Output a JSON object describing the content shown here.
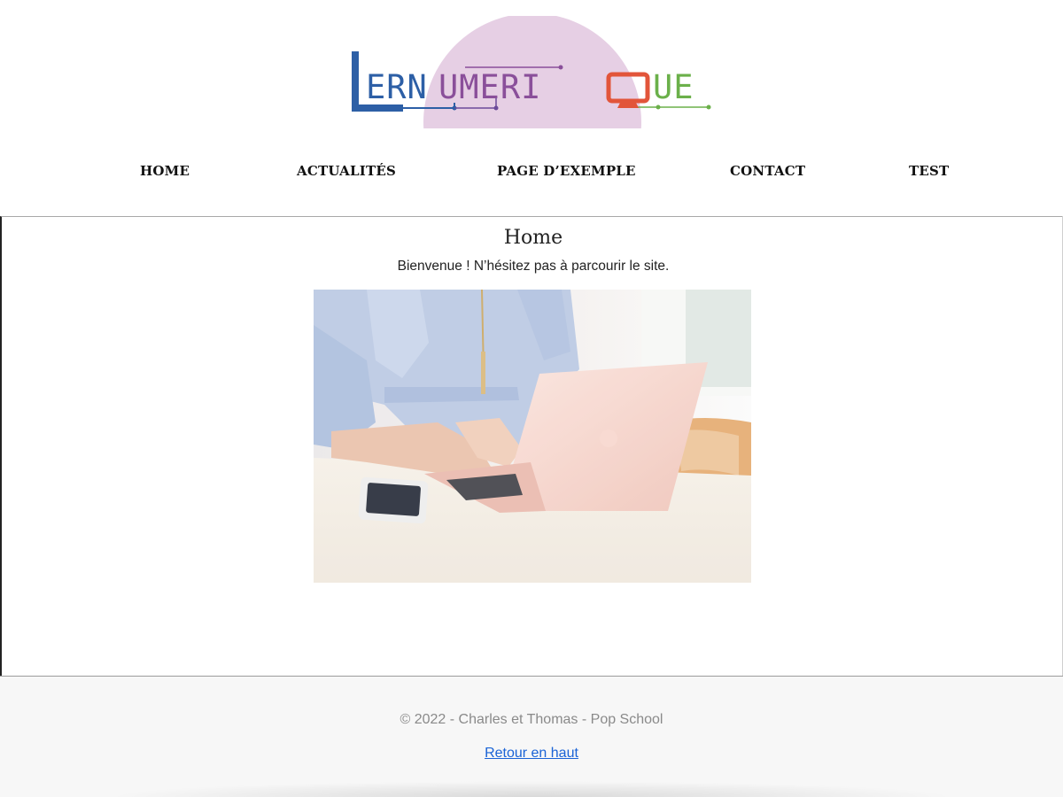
{
  "logo": {
    "text": "LERNUMERIQUE",
    "colors": {
      "circle": "#e6cfe4",
      "blue": "#2d5fa6",
      "purple": "#8a4f9a",
      "orange": "#e2553a",
      "green": "#6bb04a"
    }
  },
  "nav": {
    "items": [
      {
        "label": "HOME"
      },
      {
        "label": "ACTUALITÉS"
      },
      {
        "label": "PAGE D’EXEMPLE"
      },
      {
        "label": "CONTACT"
      },
      {
        "label": "TEST"
      }
    ]
  },
  "main": {
    "title": "Home",
    "intro": "Bienvenue ! N’hésitez pas à parcourir le site.",
    "image_subject": "person-typing-on-pink-laptop"
  },
  "footer": {
    "copyright": "© 2022 - Charles et Thomas - Pop School",
    "back_to_top": "Retour en haut",
    "link_color": "#1a63d6"
  }
}
